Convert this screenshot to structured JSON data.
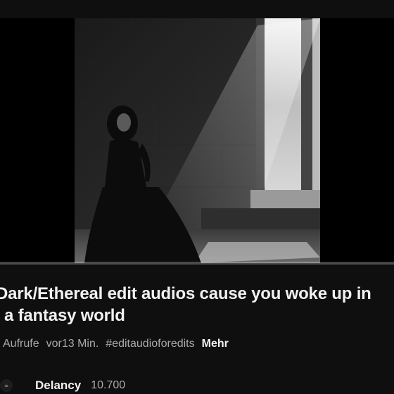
{
  "video": {
    "title_line1": "Dark/Ethereal edit audios cause you woke up in",
    "title_line2": "a fantasy world",
    "progress_fraction": 0
  },
  "meta": {
    "views": "Aufrufe",
    "age": "vor13 Min.",
    "hashtag": "#editaudioforedits",
    "more": "Mehr"
  },
  "channel": {
    "avatar_text": "☕",
    "name": "Delancy",
    "subscribers": "10.700"
  },
  "colors": {
    "background": "#0f0f0f",
    "text_primary": "#f1f1f1",
    "text_secondary": "#aaaaaa"
  }
}
